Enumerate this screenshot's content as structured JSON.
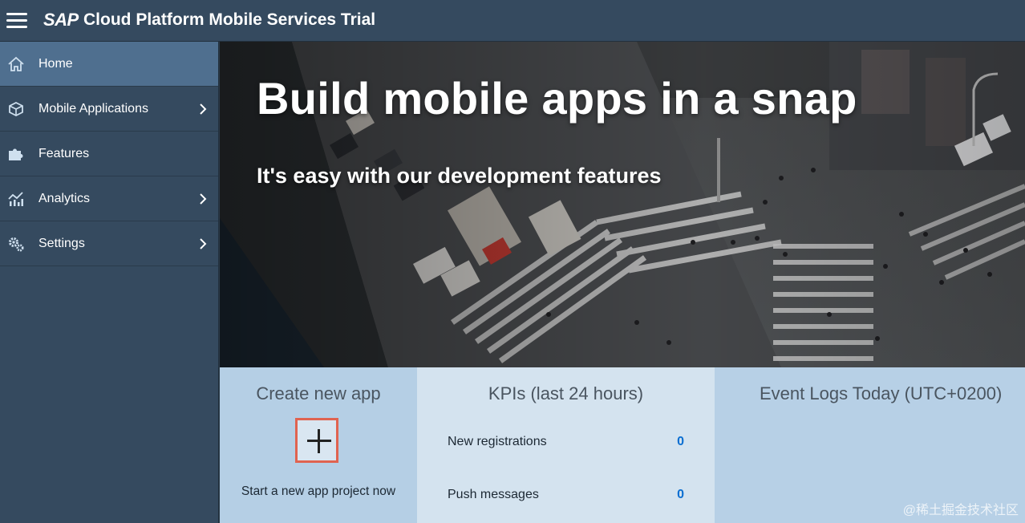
{
  "header": {
    "logo": "SAP",
    "title": "Cloud Platform Mobile Services Trial"
  },
  "sidebar": {
    "items": [
      {
        "label": "Home",
        "icon": "home-icon",
        "active": true
      },
      {
        "label": "Mobile Applications",
        "icon": "cube-icon",
        "has_submenu": true
      },
      {
        "label": "Features",
        "icon": "puzzle-icon"
      },
      {
        "label": "Analytics",
        "icon": "analytics-icon",
        "has_submenu": true
      },
      {
        "label": "Settings",
        "icon": "gears-icon",
        "has_submenu": true
      }
    ]
  },
  "hero": {
    "title": "Build mobile apps in a snap",
    "subtitle": "It's easy with our development features"
  },
  "tiles": {
    "create": {
      "title": "Create new app",
      "hint": "Start a new app project now"
    },
    "kpi": {
      "title": "KPIs (last 24 hours)",
      "rows": [
        {
          "label": "New registrations",
          "value": "0"
        },
        {
          "label": "Push messages",
          "value": "0"
        }
      ]
    },
    "events": {
      "title": "Event Logs Today (UTC+0200)"
    }
  },
  "watermark": "@稀土掘金技术社区",
  "colors": {
    "header_bg": "#354a5f",
    "sidebar_active": "#4f6f8f",
    "kpi_value": "#0a6ed1",
    "highlight_border": "#e06350"
  }
}
